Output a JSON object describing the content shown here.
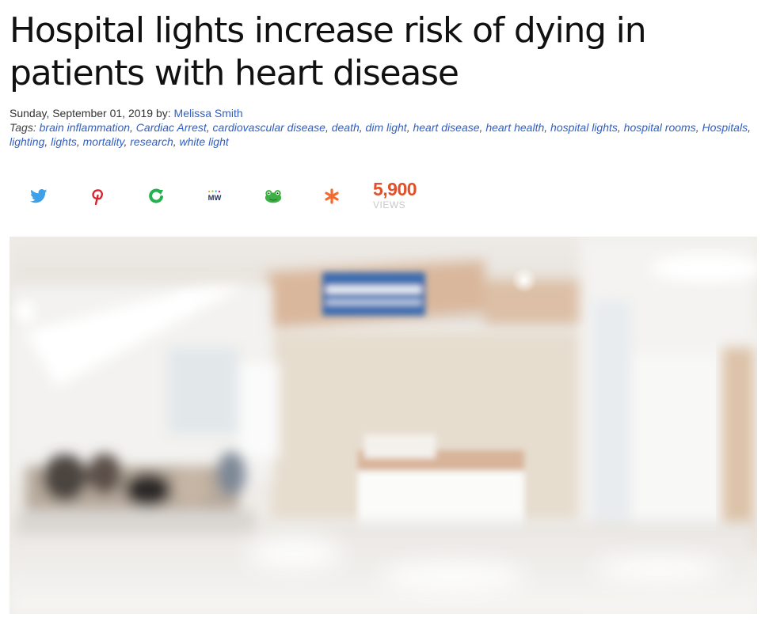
{
  "article": {
    "headline": "Hospital lights increase risk of dying in patients with heart disease",
    "byline_date": "Sunday, September 01, 2019 by: ",
    "author": "Melissa Smith",
    "tags_label": "Tags: ",
    "tags": [
      "brain inflammation",
      "Cardiac Arrest",
      "cardiovascular disease",
      "death",
      "dim light",
      "heart disease",
      "heart health",
      "hospital lights",
      "hospital rooms",
      "Hospitals",
      "lighting",
      "lights",
      "mortality",
      "research",
      "white light"
    ]
  },
  "share": {
    "buttons": [
      {
        "name": "twitter-icon",
        "color": "#3ea0e8"
      },
      {
        "name": "pinterest-icon",
        "color": "#d9232e"
      },
      {
        "name": "gab-icon",
        "color": "#23b14d"
      },
      {
        "name": "mewe-icon",
        "color": "#24315e"
      },
      {
        "name": "frog-icon",
        "color": "#3cb043"
      },
      {
        "name": "asterisk-icon",
        "color": "#f26a2e"
      }
    ],
    "views_count": "5,900",
    "views_label": "VIEWS"
  },
  "hero_image": {
    "description_icon": "hospital-lobby-photo"
  }
}
